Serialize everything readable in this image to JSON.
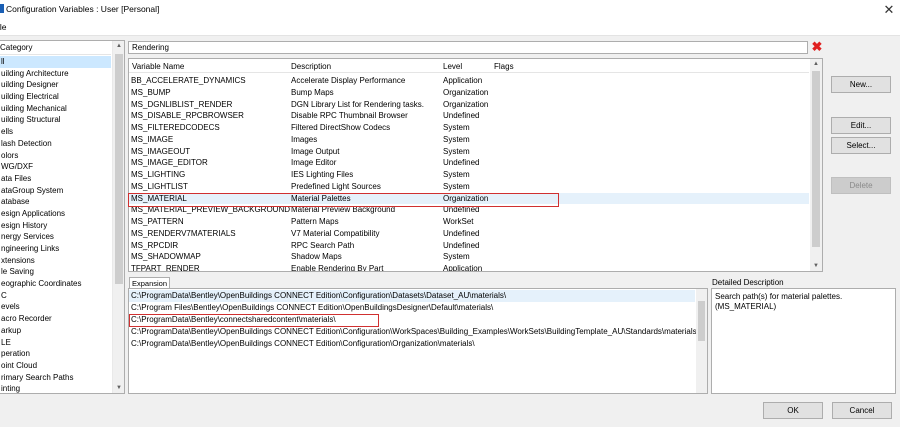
{
  "window": {
    "title": "Configuration Variables : User [Personal]",
    "close_glyph": "✕",
    "menu_file": "ile"
  },
  "category": {
    "header": "Category",
    "items": [
      "ll",
      "uilding Architecture",
      "uilding Designer",
      "uilding Electrical",
      "uilding Mechanical",
      "uilding Structural",
      "ells",
      "lash Detection",
      "olors",
      "WG/DXF",
      "ata Files",
      "ataGroup System",
      "atabase",
      "esign Applications",
      "esign History",
      "nergy Services",
      "ngineering Links",
      "xtensions",
      "le Saving",
      "eographic Coordinates",
      "C",
      "evels",
      "acro Recorder",
      "arkup",
      "LE",
      "peration",
      "oint Cloud",
      "rimary Search Paths",
      "inting"
    ],
    "selected_index": 0
  },
  "search": {
    "value": "Rendering",
    "clear_glyph": "✖"
  },
  "variables": {
    "columns": {
      "name": "Variable Name",
      "description": "Description",
      "level": "Level",
      "flags": "Flags"
    },
    "rows": [
      {
        "name": "BB_ACCELERATE_DYNAMICS",
        "description": "Accelerate Display Performance",
        "level": "Application",
        "flags": ""
      },
      {
        "name": "MS_BUMP",
        "description": "Bump Maps",
        "level": "Organization",
        "flags": ""
      },
      {
        "name": "MS_DGNLIBLIST_RENDER",
        "description": "DGN Library List for Rendering tasks.",
        "level": "Organization",
        "flags": ""
      },
      {
        "name": "MS_DISABLE_RPCBROWSER",
        "description": "Disable RPC Thumbnail Browser",
        "level": "Undefined",
        "flags": ""
      },
      {
        "name": "MS_FILTEREDCODECS",
        "description": "Filtered DirectShow Codecs",
        "level": "System",
        "flags": ""
      },
      {
        "name": "MS_IMAGE",
        "description": "Images",
        "level": "System",
        "flags": ""
      },
      {
        "name": "MS_IMAGEOUT",
        "description": "Image Output",
        "level": "System",
        "flags": ""
      },
      {
        "name": "MS_IMAGE_EDITOR",
        "description": "Image Editor",
        "level": "Undefined",
        "flags": ""
      },
      {
        "name": "MS_LIGHTING",
        "description": "IES Lighting Files",
        "level": "System",
        "flags": ""
      },
      {
        "name": "MS_LIGHTLIST",
        "description": "Predefined Light Sources",
        "level": "System",
        "flags": ""
      },
      {
        "name": "MS_MATERIAL",
        "description": "Material Palettes",
        "level": "Organization",
        "flags": ""
      },
      {
        "name": "MS_MATERIAL_PREVIEW_BACKGROUND",
        "description": "Material Preview Background",
        "level": "Undefined",
        "flags": ""
      },
      {
        "name": "MS_PATTERN",
        "description": "Pattern Maps",
        "level": "WorkSet",
        "flags": ""
      },
      {
        "name": "MS_RENDERV7MATERIALS",
        "description": "V7 Material Compatibility",
        "level": "Undefined",
        "flags": ""
      },
      {
        "name": "MS_RPCDIR",
        "description": "RPC Search Path",
        "level": "Undefined",
        "flags": ""
      },
      {
        "name": "MS_SHADOWMAP",
        "description": "Shadow Maps",
        "level": "System",
        "flags": ""
      },
      {
        "name": "TFPART_RENDER",
        "description": "Enable Rendering By Part",
        "level": "Application",
        "flags": ""
      }
    ],
    "selected_index": 10
  },
  "buttons": {
    "new": "New...",
    "edit": "Edit...",
    "select": "Select...",
    "delete": "Delete",
    "ok": "OK",
    "cancel": "Cancel"
  },
  "expansion": {
    "label": "Expansion",
    "rows": [
      "C:\\ProgramData\\Bentley\\OpenBuildings CONNECT Edition\\Configuration\\Datasets\\Dataset_AU\\materials\\",
      "C:\\Program Files\\Bentley\\OpenBuildings CONNECT Edition\\OpenBuildingsDesigner\\Default\\materials\\",
      "C:\\ProgramData\\Bentley\\connectsharedcontent\\materials\\",
      "C:\\ProgramData\\Bentley\\OpenBuildings CONNECT Edition\\Configuration\\WorkSpaces\\Building_Examples\\WorkSets\\BuildingTemplate_AU\\Standards\\materials\\",
      "C:\\ProgramData\\Bentley\\OpenBuildings CONNECT Edition\\Configuration\\Organization\\materials\\"
    ],
    "selected_index": 0
  },
  "detailed_description": {
    "label": "Detailed Description",
    "line1": "Search path(s) for material palettes.",
    "line2": "(MS_MATERIAL)"
  },
  "colors": {
    "highlight_outline": "#d03030",
    "selection": "#cce8ff",
    "row_selection": "#e5f1fb",
    "clear_icon": "#e02020"
  }
}
